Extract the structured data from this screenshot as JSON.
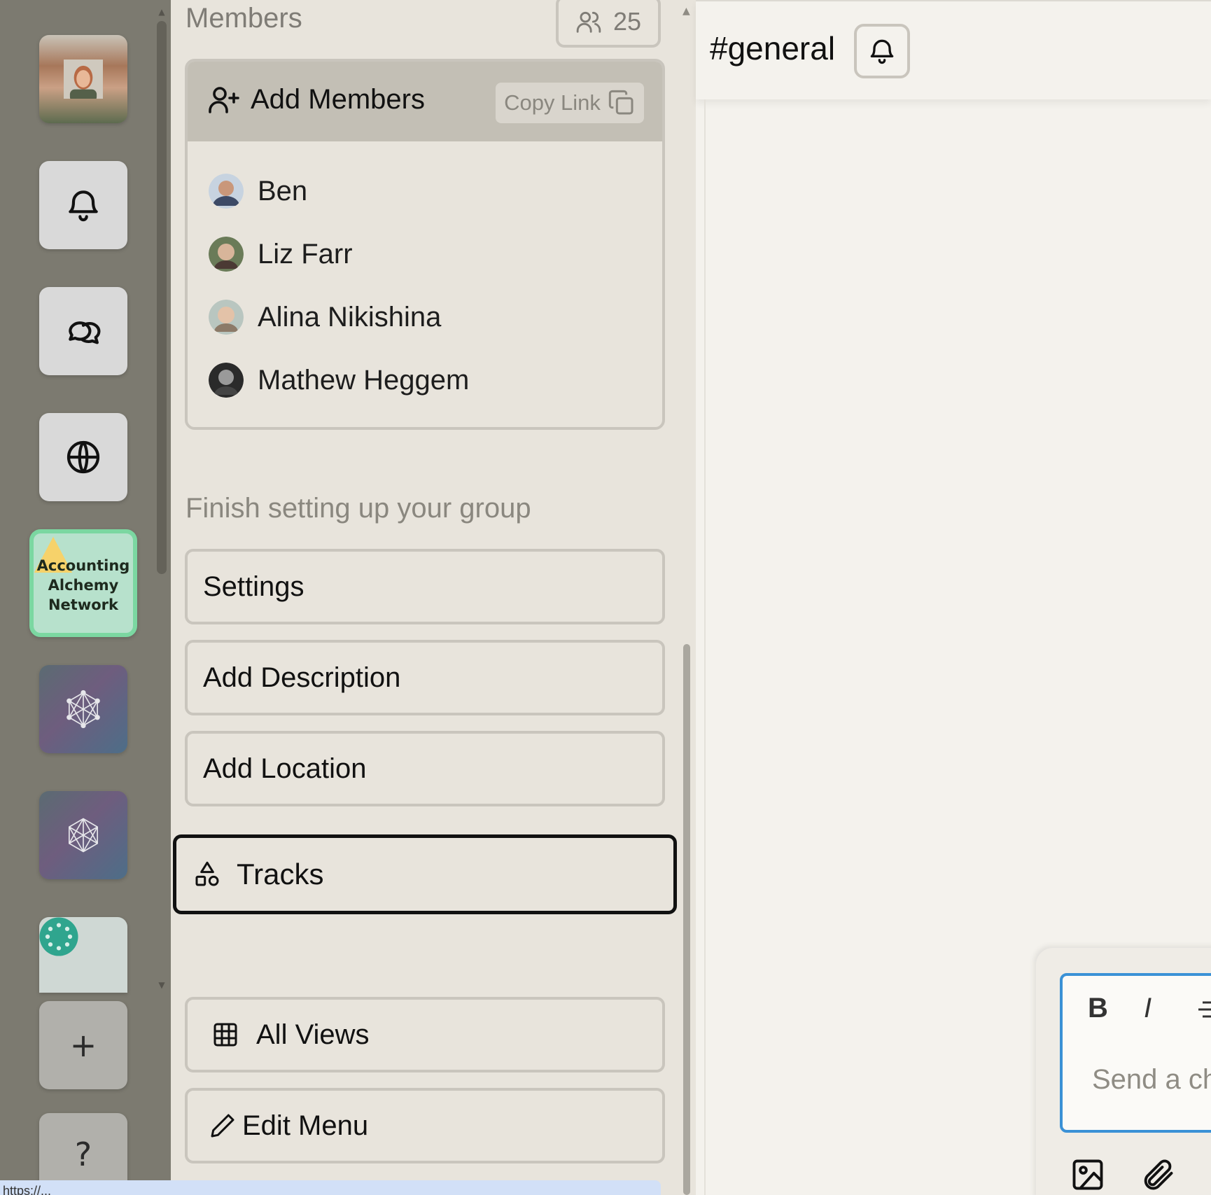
{
  "rail": {
    "add_label": "+",
    "help_label": "?",
    "groups": [
      {
        "name": "Accounting Alchemy Network",
        "lines": [
          "Accounting",
          "Alchemy",
          "Network"
        ]
      }
    ]
  },
  "members": {
    "title": "Members",
    "count": "25",
    "add_label": "Add Members",
    "copy_link_label": "Copy Link",
    "list": [
      {
        "name": "Ben"
      },
      {
        "name": "Liz Farr"
      },
      {
        "name": "Alina Nikishina"
      },
      {
        "name": "Mathew Heggem"
      }
    ]
  },
  "setup": {
    "title": "Finish setting up your group",
    "settings_label": "Settings",
    "description_label": "Add Description",
    "location_label": "Add Location"
  },
  "nav": {
    "tracks_label": "Tracks",
    "all_views_label": "All Views",
    "edit_menu_label": "Edit Menu"
  },
  "chat": {
    "channel": "#general",
    "composer_placeholder": "Send a ch",
    "format": {
      "bold": "B",
      "italic": "I"
    }
  },
  "status_url": "https://...",
  "colors": {
    "rail": "#7c7a70",
    "panel": "#e8e4dc",
    "active_group_border": "#7bd7a1",
    "composer_focus": "#3a91d6"
  }
}
